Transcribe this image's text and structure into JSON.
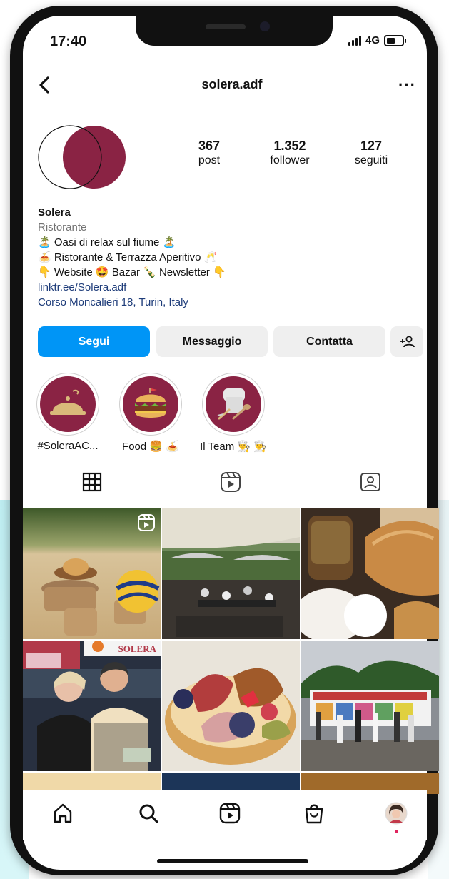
{
  "status": {
    "time": "17:40",
    "network": "4G"
  },
  "header": {
    "username": "solera.adf",
    "back_icon": "chevron-left-icon",
    "more_icon": "more-dots-icon",
    "more_text": "···"
  },
  "profile": {
    "stats": [
      {
        "value": "367",
        "label": "post"
      },
      {
        "value": "1.352",
        "label": "follower"
      },
      {
        "value": "127",
        "label": "seguiti"
      }
    ],
    "name": "Solera",
    "category": "Ristorante",
    "bio_lines": [
      "🏝️ Oasi di relax sul fiume 🏝️",
      "🍝 Ristorante & Terrazza Aperitivo 🥂",
      "👇 Website 🤩 Bazar 🍾 Newsletter 👇"
    ],
    "link": "linktr.ee/Solera.adf",
    "address": "Corso Moncalieri 18, Turin, Italy"
  },
  "actions": {
    "follow": "Segui",
    "message": "Messaggio",
    "contact": "Contatta",
    "add_user_icon": "add-user-icon"
  },
  "highlights": [
    {
      "label": "#SoleraAC...",
      "icon": "cloche-icon"
    },
    {
      "label": "Food 🍔 🍝",
      "icon": "burger-icon"
    },
    {
      "label": "Il Team 👨‍🍳 👨‍🍳",
      "icon": "chef-tools-icon"
    }
  ],
  "tabs": [
    {
      "name": "grid",
      "icon": "grid-icon",
      "active": true
    },
    {
      "name": "reels",
      "icon": "reels-icon",
      "active": false
    },
    {
      "name": "tagged",
      "icon": "tagged-icon",
      "active": false
    }
  ],
  "posts": [
    {
      "desc": "burger on sand with volleyball",
      "reel": true,
      "badge_text": ""
    },
    {
      "desc": "terrace with umbrellas and guests",
      "reel": false,
      "badge_text": ""
    },
    {
      "desc": "jar, bread and ricotta",
      "reel": false,
      "badge_text": ""
    },
    {
      "desc": "two staff members at the bar",
      "reel": false,
      "badge_text": "SOLERA"
    },
    {
      "desc": "fruit tart with figs and berries",
      "reel": false,
      "badge_text": ""
    },
    {
      "desc": "kiosk with people outdoors",
      "reel": false,
      "badge_text": ""
    }
  ],
  "bottom_nav": [
    {
      "name": "home",
      "icon": "home-icon"
    },
    {
      "name": "search",
      "icon": "search-icon"
    },
    {
      "name": "reels",
      "icon": "reels-icon"
    },
    {
      "name": "shop",
      "icon": "shop-bag-icon"
    },
    {
      "name": "profile",
      "icon": "profile-avatar-icon"
    }
  ],
  "colors": {
    "accent": "#0095f6",
    "brand": "#8a2344",
    "button_grey": "#efefef"
  }
}
